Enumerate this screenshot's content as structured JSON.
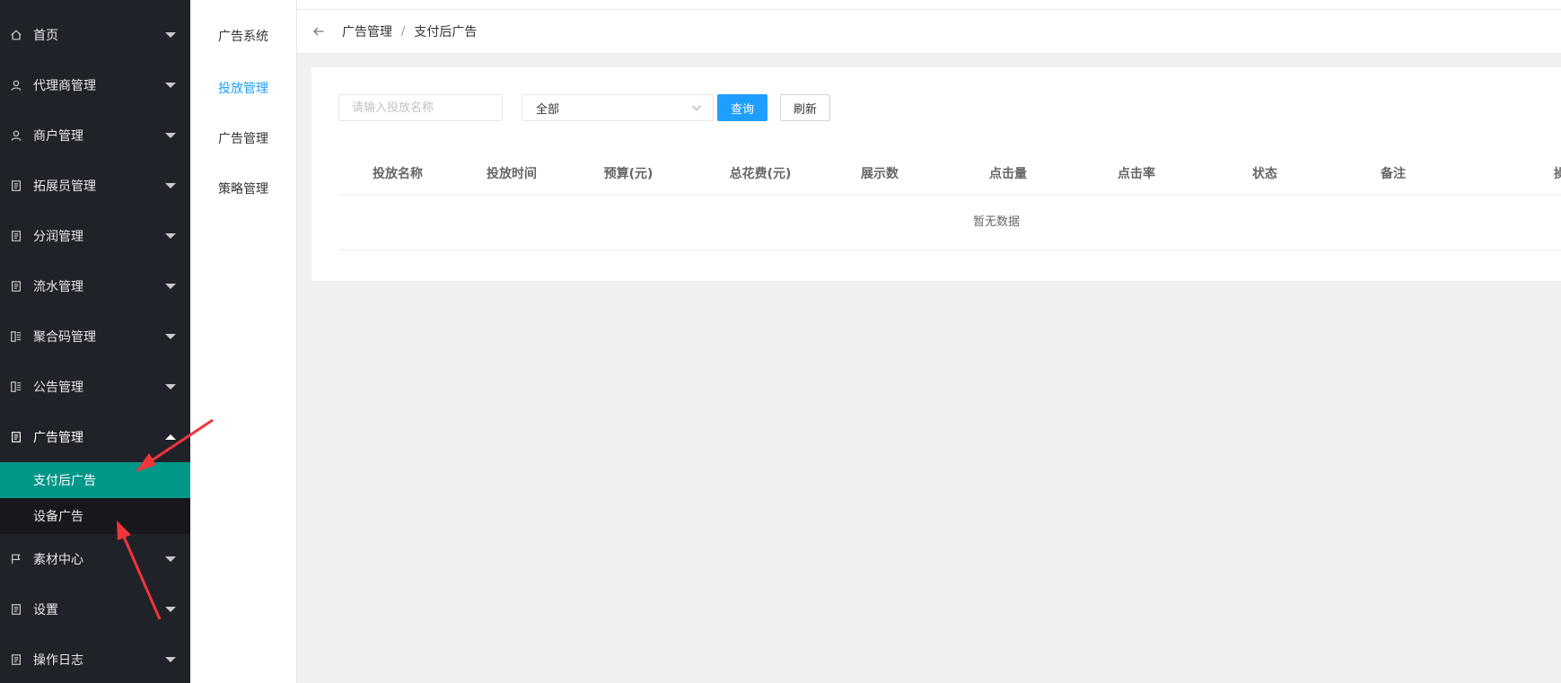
{
  "sidebar": {
    "items": [
      {
        "label": "首页",
        "icon": "home-icon"
      },
      {
        "label": "代理商管理",
        "icon": "user-icon"
      },
      {
        "label": "商户管理",
        "icon": "user-icon"
      },
      {
        "label": "拓展员管理",
        "icon": "doc-icon"
      },
      {
        "label": "分润管理",
        "icon": "doc-icon"
      },
      {
        "label": "流水管理",
        "icon": "doc-icon"
      },
      {
        "label": "聚合码管理",
        "icon": "list-icon"
      },
      {
        "label": "公告管理",
        "icon": "list-icon"
      },
      {
        "label": "广告管理",
        "icon": "doc-icon",
        "expanded": true
      },
      {
        "label": "素材中心",
        "icon": "flag-icon"
      },
      {
        "label": "设置",
        "icon": "doc-icon"
      },
      {
        "label": "操作日志",
        "icon": "doc-icon"
      }
    ],
    "sub_items": [
      {
        "label": "支付后广告",
        "active": true
      },
      {
        "label": "设备广告",
        "active": false
      }
    ],
    "bg_color": "#20222a",
    "active_color": "#009688"
  },
  "subpanel": {
    "items": [
      {
        "label": "广告系统",
        "active": false
      },
      {
        "label": "投放管理",
        "active": true
      },
      {
        "label": "广告管理",
        "active": false
      },
      {
        "label": "策略管理",
        "active": false
      }
    ],
    "active_color": "#1e9fff"
  },
  "breadcrumb": {
    "parent": "广告管理",
    "separator": "/",
    "current": "支付后广告"
  },
  "filters": {
    "search_placeholder": "请输入投放名称",
    "search_value": "",
    "status_selected": "全部",
    "query_label": "查询",
    "refresh_label": "刷新",
    "query_color": "#1e9fff"
  },
  "table": {
    "columns": [
      "投放名称",
      "投放时间",
      "预算(元)",
      "总花费(元)",
      "展示数",
      "点击量",
      "点击率",
      "状态",
      "备注",
      "操"
    ],
    "empty_text": "暂无数据"
  },
  "annotations": {
    "arrow_color": "#f0353b"
  }
}
